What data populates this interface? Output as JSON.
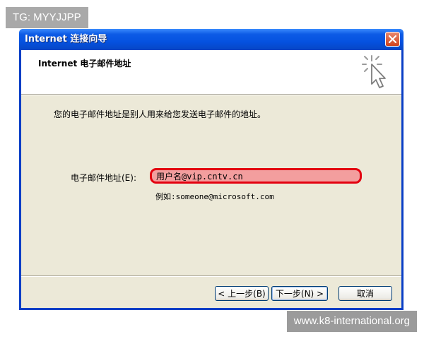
{
  "watermarks": {
    "top_left": "TG: MYYJJPP",
    "bottom_right": "www.k8-international.org"
  },
  "window": {
    "title": "Internet 连接向导",
    "close_icon": "close-icon"
  },
  "header": {
    "title": "Internet 电子邮件地址",
    "icon": "wizard-cursor-icon"
  },
  "body": {
    "description": "您的电子邮件地址是别人用来给您发送电子邮件的地址。",
    "email_label": "电子邮件地址(E):",
    "email_value": "用户名@vip.cntv.cn",
    "example": "例如:someone@microsoft.com"
  },
  "buttons": {
    "back": "< 上一步(B)",
    "next": "下一步(N) >",
    "cancel": "取消"
  },
  "colors": {
    "titlebar": "#0552e0",
    "dialog_bg": "#ece9d8",
    "highlight": "#e3000f"
  }
}
